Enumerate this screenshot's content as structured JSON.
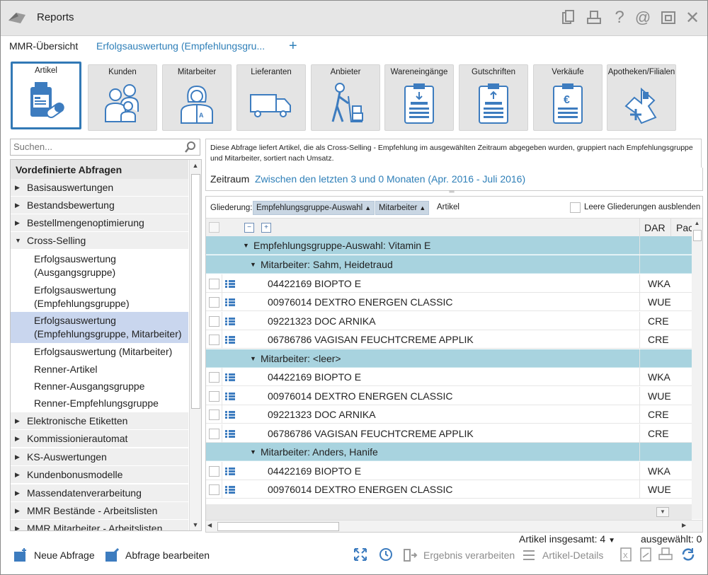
{
  "window": {
    "title": "Reports",
    "titlebar_icons": [
      "document-icon",
      "print-icon",
      "help-icon",
      "email-icon",
      "window-icon",
      "close-icon"
    ]
  },
  "tabs": {
    "overview": "MMR-Übersicht",
    "active": "Erfolgsauswertung (Empfehlungsgru...",
    "add": "+"
  },
  "categories": [
    {
      "label": "Artikel",
      "icon": "medicine-icon"
    },
    {
      "label": "Kunden",
      "icon": "family-icon"
    },
    {
      "label": "Mitarbeiter",
      "icon": "pharmacist-icon"
    },
    {
      "label": "Lieferanten",
      "icon": "truck-icon"
    },
    {
      "label": "Anbieter",
      "icon": "courier-icon"
    },
    {
      "label": "Wareneingänge",
      "icon": "clipboard-in-icon"
    },
    {
      "label": "Gutschriften",
      "icon": "clipboard-credit-icon"
    },
    {
      "label": "Verkäufe",
      "icon": "clipboard-euro-icon"
    },
    {
      "label": "Apotheken/Filialen",
      "icon": "pharmacy-map-icon"
    }
  ],
  "search": {
    "placeholder": "Suchen..."
  },
  "tree": {
    "header": "Vordefinierte Abfragen",
    "items_top": [
      "Basisauswertungen",
      "Bestandsbewertung",
      "Bestellmengenoptimierung"
    ],
    "expanded": "Cross-Selling",
    "children": [
      "Erfolgsauswertung\n(Ausgangsgruppe)",
      "Erfolgsauswertung\n(Empfehlungsgruppe)",
      "Erfolgsauswertung\n(Empfehlungsgruppe, Mitarbeiter)",
      "Erfolgsauswertung (Mitarbeiter)",
      "Renner-Artikel",
      "Renner-Ausgangsgruppe",
      "Renner-Empfehlungsgruppe"
    ],
    "items_bottom": [
      "Elektronische Etiketten",
      "Kommissionierautomat",
      "KS-Auswertungen",
      "Kundenbonusmodelle",
      "Massendatenverarbeitung",
      "MMR Bestände - Arbeitslisten",
      "MMR Mitarbeiter - Arbeitslisten"
    ]
  },
  "description": "Diese Abfrage liefert Artikel, die als Cross-Selling - Empfehlung im ausgewählten Zeitraum abgegeben wurden, gruppiert nach Empfehlungsgruppe und Mitarbeiter, sortiert nach Umsatz.",
  "zeitraum": {
    "label": "Zeitraum",
    "value": "Zwischen den letzten 3 und 0 Monaten (Apr. 2016 - Juli 2016)"
  },
  "gliederung": {
    "label": "Gliederung:",
    "chip1": "Empfehlungsgruppe-Auswahl",
    "chip2": "Mitarbeiter",
    "chip3": "Artikel",
    "hide_empty": "Leere Gliederungen ausblenden"
  },
  "columns": {
    "dar": "DAR",
    "pac": "Pac"
  },
  "rows": [
    {
      "type": "group1",
      "text": "Empfehlungsgruppe-Auswahl: Vitamin E"
    },
    {
      "type": "group2",
      "text": "Mitarbeiter: Sahm, Heidetraud"
    },
    {
      "type": "item",
      "text": "04422169 BIOPTO E",
      "dar": "WKA"
    },
    {
      "type": "item",
      "text": "00976014 DEXTRO ENERGEN CLASSIC",
      "dar": "WUE"
    },
    {
      "type": "item",
      "text": "09221323 DOC ARNIKA",
      "dar": "CRE"
    },
    {
      "type": "item",
      "text": "06786786 VAGISAN FEUCHTCREME APPLIK",
      "dar": "CRE"
    },
    {
      "type": "group2",
      "text": "Mitarbeiter: <leer>"
    },
    {
      "type": "item",
      "text": "04422169 BIOPTO E",
      "dar": "WKA"
    },
    {
      "type": "item",
      "text": "00976014 DEXTRO ENERGEN CLASSIC",
      "dar": "WUE"
    },
    {
      "type": "item",
      "text": "09221323 DOC ARNIKA",
      "dar": "CRE"
    },
    {
      "type": "item",
      "text": "06786786 VAGISAN FEUCHTCREME APPLIK",
      "dar": "CRE"
    },
    {
      "type": "group2",
      "text": "Mitarbeiter: Anders, Hanife"
    },
    {
      "type": "item",
      "text": "04422169 BIOPTO E",
      "dar": "WKA"
    },
    {
      "type": "item",
      "text": "00976014 DEXTRO ENERGEN CLASSIC",
      "dar": "WUE"
    }
  ],
  "status": {
    "total": "Artikel insgesamt: 4",
    "selected": "ausgewählt: 0"
  },
  "toolbar": {
    "new_query": "Neue Abfrage",
    "edit_query": "Abfrage bearbeiten",
    "process_result": "Ergebnis verarbeiten",
    "article_details": "Artikel-Details"
  },
  "colors": {
    "accent": "#3279b6",
    "link": "#2e7fb8",
    "group_row": "#a8d3df",
    "selected_tree": "#c9d6ee"
  }
}
